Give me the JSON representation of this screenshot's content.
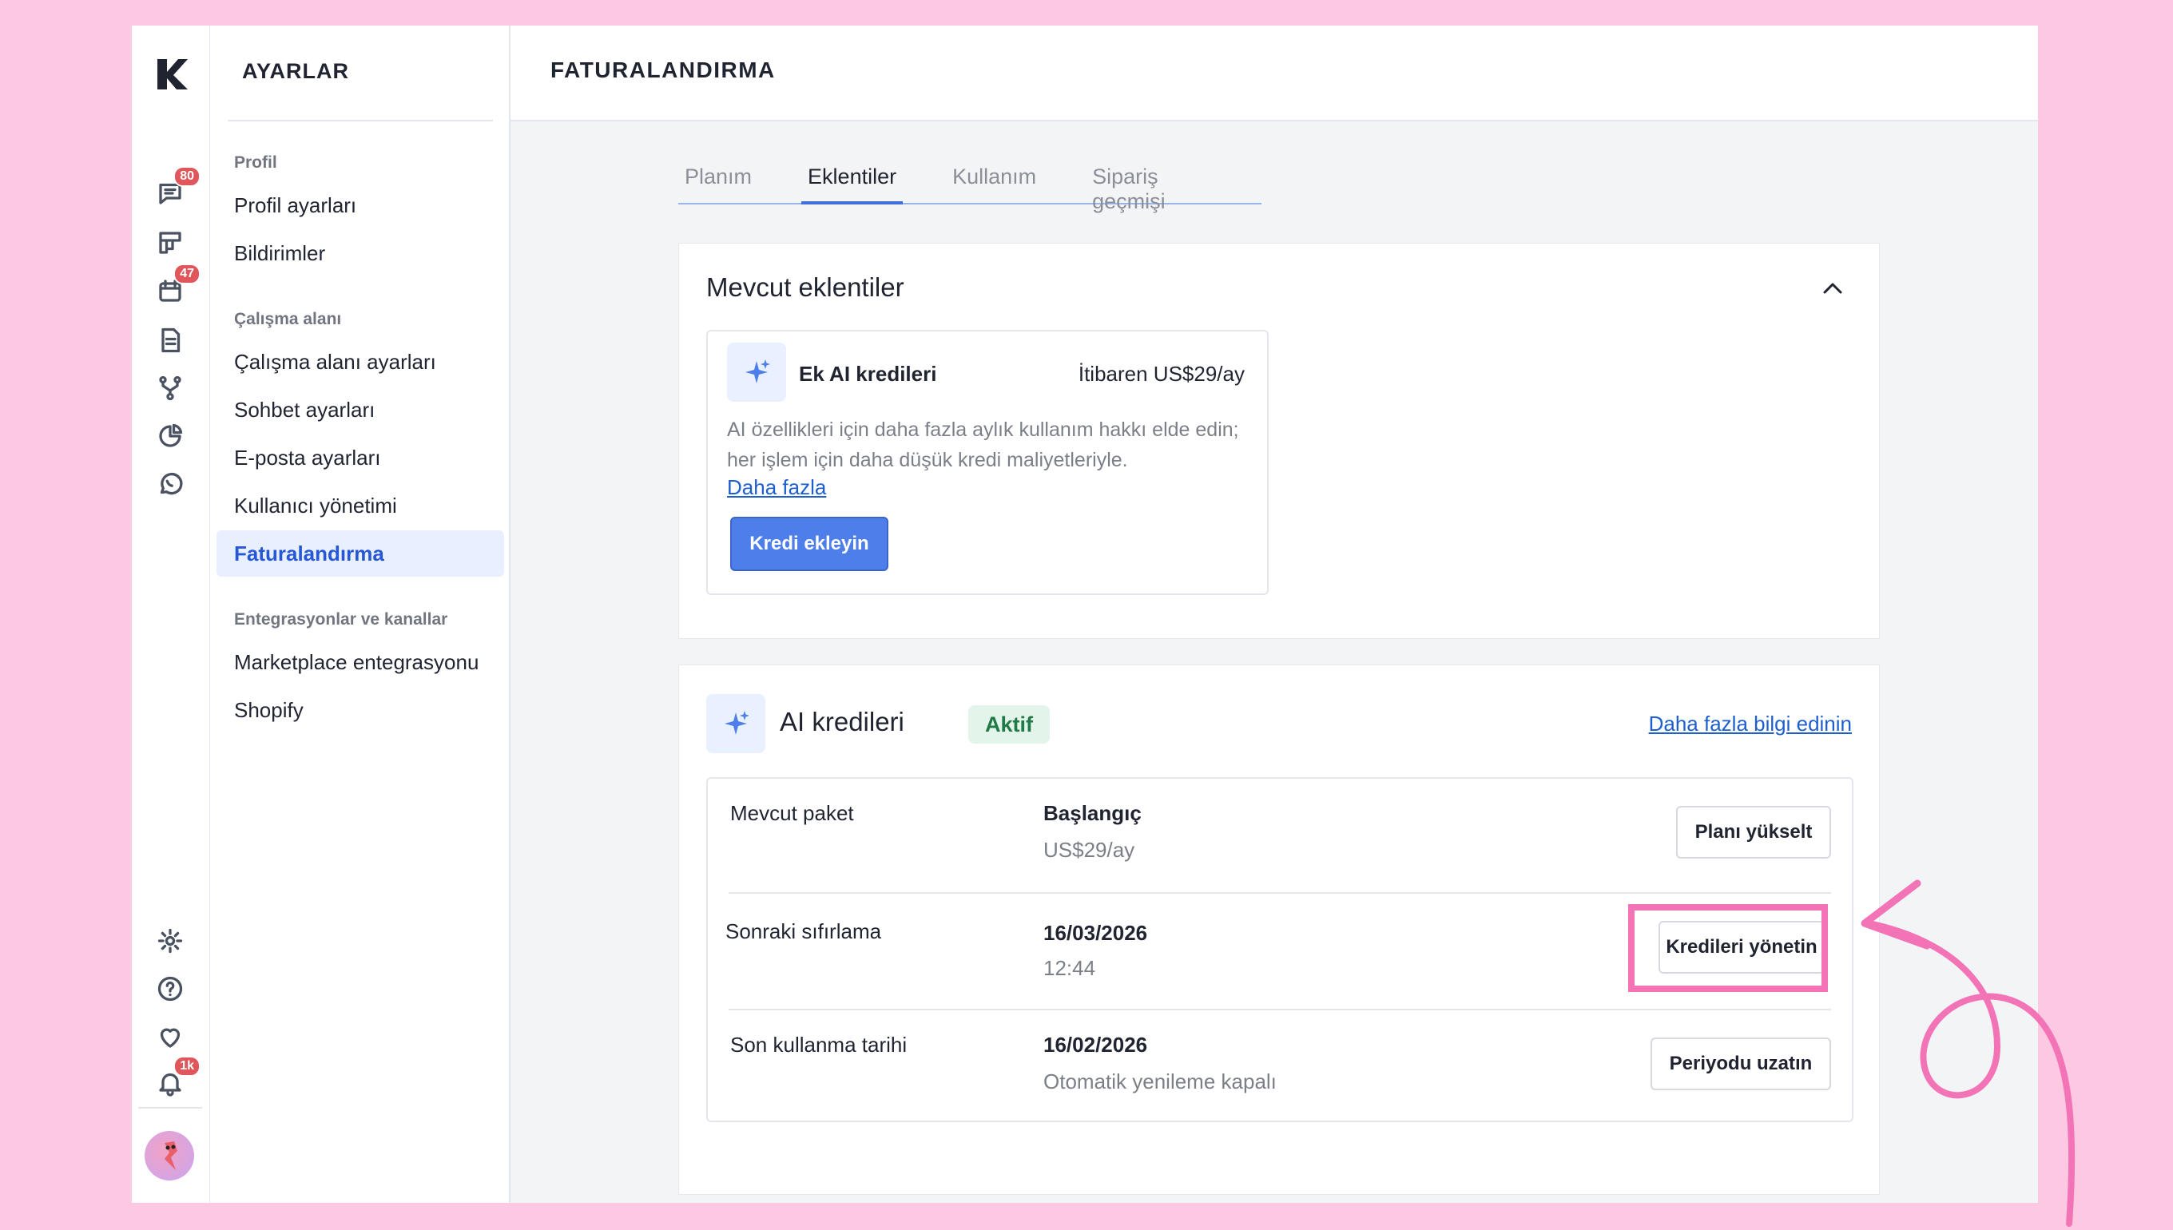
{
  "rail": {
    "badges": {
      "chat": "80",
      "calendar": "47",
      "notifications": "1k"
    },
    "icons": [
      "logo-icon",
      "chat-icon",
      "board-icon",
      "calendar-icon",
      "document-icon",
      "workflow-icon",
      "pie-chart-icon",
      "whatsapp-icon",
      "settings-icon",
      "help-icon",
      "heart-icon",
      "bell-icon",
      "avatar"
    ]
  },
  "settings": {
    "title": "AYARLAR",
    "groups": [
      {
        "label": "Profil",
        "items": [
          "Profil ayarları",
          "Bildirimler"
        ]
      },
      {
        "label": "Çalışma alanı",
        "items": [
          "Çalışma alanı ayarları",
          "Sohbet ayarları",
          "E-posta ayarları",
          "Kullanıcı yönetimi",
          "Faturalandırma"
        ]
      },
      {
        "label": "Entegrasyonlar ve kanallar",
        "items": [
          "Marketplace entegrasyonu",
          "Shopify"
        ]
      }
    ],
    "active_item": "Faturalandırma"
  },
  "main": {
    "title": "FATURALANDIRMA",
    "tabs": [
      "Planım",
      "Eklentiler",
      "Kullanım",
      "Sipariş geçmişi"
    ],
    "active_tab": "Eklentiler"
  },
  "addons": {
    "title": "Mevcut eklentiler",
    "addon": {
      "name": "Ek AI kredileri",
      "price": "İtibaren US$29/ay",
      "description": "AI özellikleri için daha fazla aylık kullanım hakkı elde edin; her işlem için daha düşük kredi maliyetleriyle.",
      "link": "Daha fazla",
      "button": "Kredi ekleyin"
    }
  },
  "credits": {
    "title": "AI kredileri",
    "status": "Aktif",
    "learn_more": "Daha fazla bilgi edinin",
    "rows": [
      {
        "label": "Mevcut paket",
        "value": "Başlangıç",
        "sub": "US$29/ay",
        "button": "Planı yükselt"
      },
      {
        "label": "Sonraki sıfırlama",
        "value": "16/03/2026",
        "sub": "12:44",
        "button": "Kredileri yönetin"
      },
      {
        "label": "Son kullanma tarihi",
        "value": "16/02/2026",
        "sub": "Otomatik yenileme kapalı",
        "button": "Periyodu uzatın"
      }
    ]
  },
  "colors": {
    "accent": "#3f6fdc",
    "highlight": "#f373b7",
    "background": "#fdc8e1",
    "status_active": "#1f7a47"
  }
}
